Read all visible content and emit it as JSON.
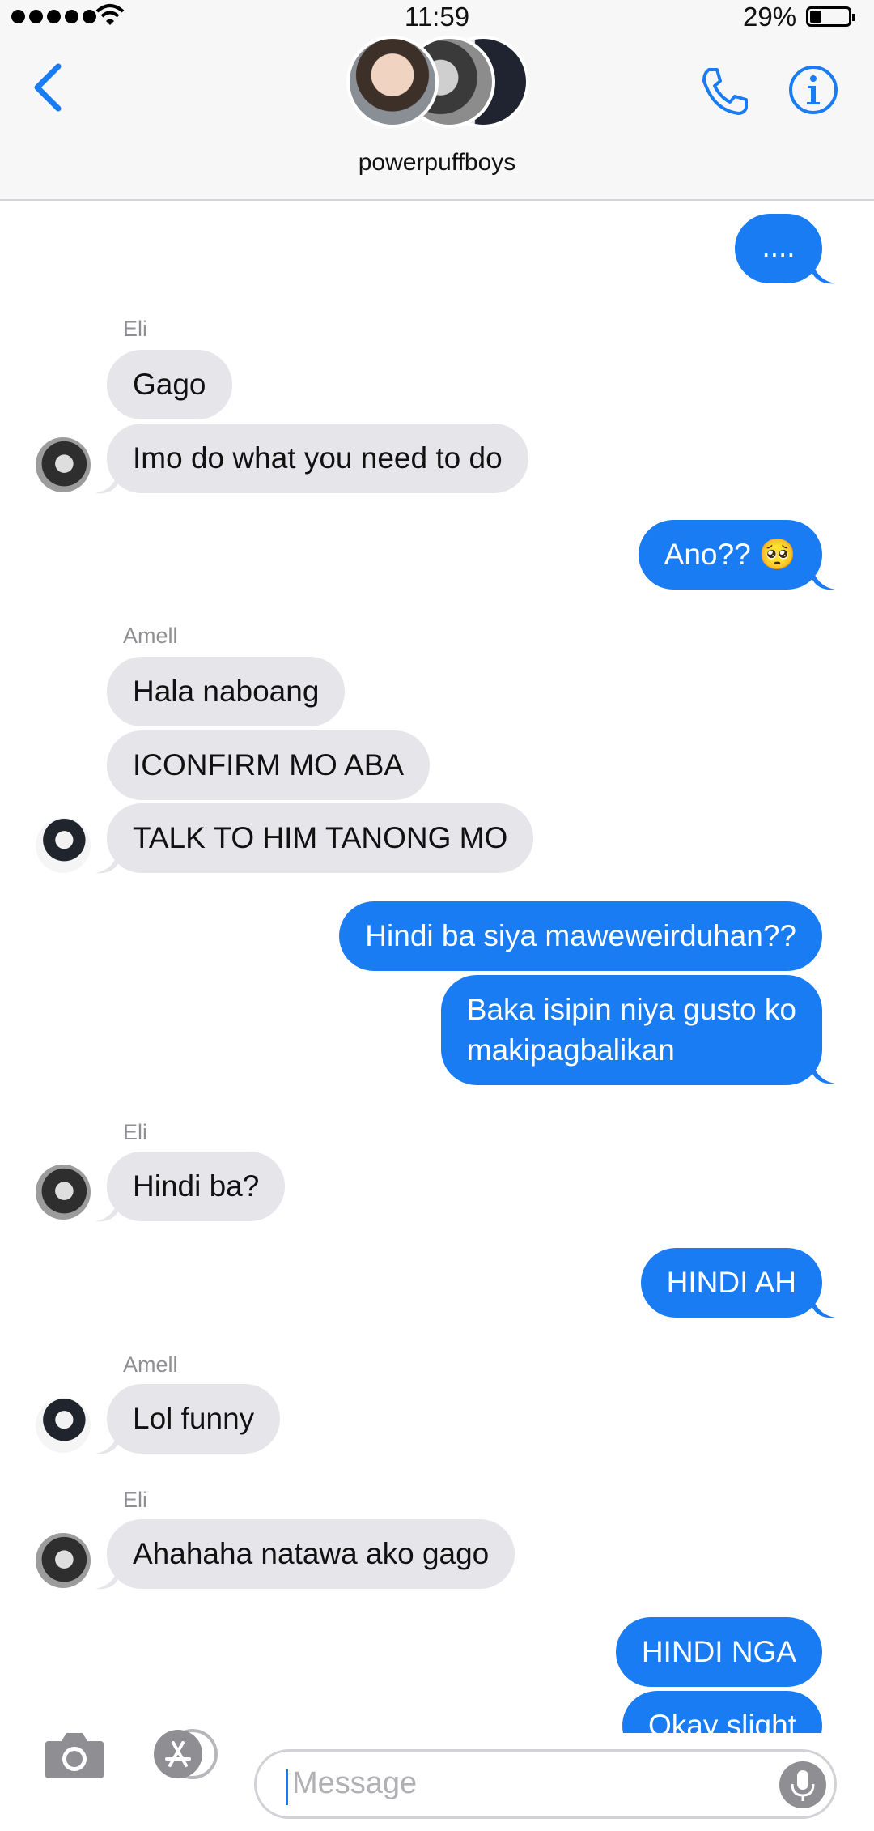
{
  "status_bar": {
    "time": "11:59",
    "battery_percent": "29%",
    "signal_dots": 5
  },
  "header": {
    "group_name": "powerpuffboys",
    "back_icon": "chevron-left-icon",
    "call_icon": "phone-icon",
    "info_icon": "info-icon"
  },
  "messages": [
    {
      "direction": "out",
      "text": "...."
    },
    {
      "direction": "in",
      "sender": "Eli",
      "text": "Gago"
    },
    {
      "direction": "in",
      "text": "Imo do what you need to do"
    },
    {
      "direction": "out",
      "text": "Ano?? 🥺"
    },
    {
      "direction": "in",
      "sender": "Amell",
      "text": "Hala naboang"
    },
    {
      "direction": "in",
      "text": "ICONFIRM MO ABA"
    },
    {
      "direction": "in",
      "text": "TALK TO HIM TANONG MO"
    },
    {
      "direction": "out",
      "text": "Hindi ba siya maweweirduhan??"
    },
    {
      "direction": "out",
      "text_line1": "Baka isipin niya gusto ko",
      "text_line2": "makipagbalikan"
    },
    {
      "direction": "in",
      "sender": "Eli",
      "text": "Hindi ba?"
    },
    {
      "direction": "out",
      "text": "HINDI AH"
    },
    {
      "direction": "in",
      "sender": "Amell",
      "text": "Lol funny"
    },
    {
      "direction": "in",
      "sender": "Eli",
      "text": "Ahahaha natawa ako gago"
    },
    {
      "direction": "out",
      "text": "HINDI NGA"
    },
    {
      "direction": "out",
      "text": "Okay slight"
    }
  ],
  "composer": {
    "placeholder": "Message",
    "camera_icon": "camera-icon",
    "apps_icon": "app-store-icon",
    "mic_icon": "microphone-icon"
  },
  "colors": {
    "outgoing": "#1a7cf3",
    "incoming": "#e5e5ea",
    "accent": "#1a7cf3"
  }
}
